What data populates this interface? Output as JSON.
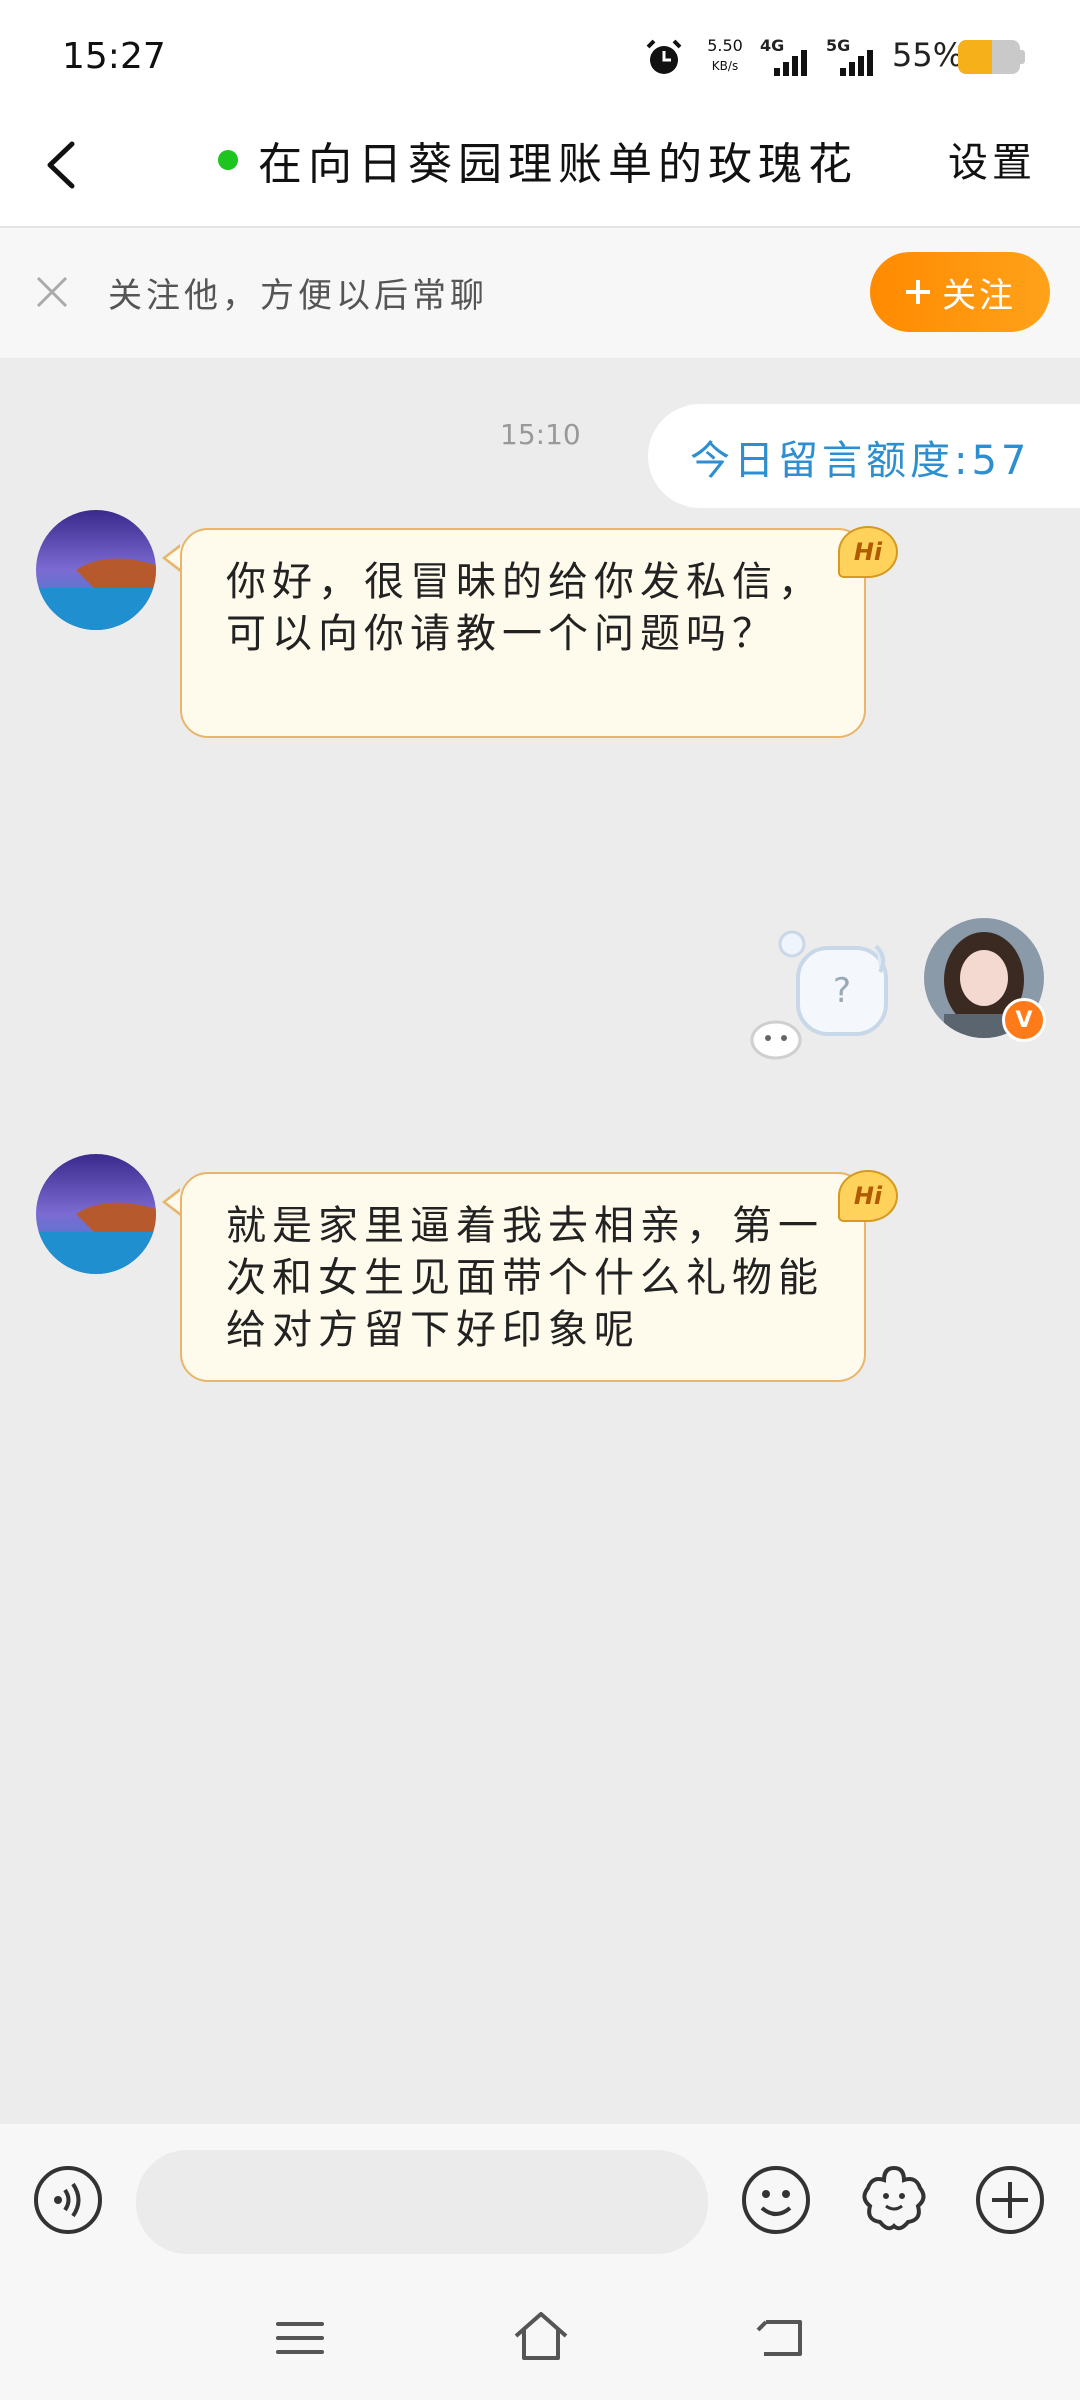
{
  "status_bar": {
    "time": "15:27",
    "net_speed_value": "5.50",
    "net_speed_unit": "KB/s",
    "signal_1_label": "4G",
    "signal_2_label": "5G",
    "battery_percent": "55%",
    "battery_level": 0.55,
    "battery_color": "#f6b11a"
  },
  "header": {
    "title": "在向日葵园理账单的玫瑰花",
    "settings_label": "设置",
    "online_color": "#1ec51e"
  },
  "follow_bar": {
    "hint": "关注他，方便以后常聊",
    "button_label": "关注",
    "button_color": "#ff8a00"
  },
  "chat": {
    "timestamp": "15:10",
    "quota_text": "今日留言额度:57",
    "messages": [
      {
        "from": "other",
        "text": "你好，很冒昧的给你发私信，可以向你请教一个问题吗？",
        "badge": "Hi"
      },
      {
        "from": "self",
        "sticker": "question-mark-bubble",
        "badge_symbol": "?"
      },
      {
        "from": "other",
        "text": "就是家里逼着我去相亲，第一次和女生见面带个什么礼物能给对方留下好印象呢",
        "badge": "Hi"
      }
    ],
    "verified_symbol": "V"
  },
  "input_bar": {
    "placeholder": "",
    "icons": [
      "voice-icon",
      "emoji-icon",
      "sticker-flower-icon",
      "plus-icon"
    ]
  },
  "nav_bar": {
    "icons": [
      "menu-icon",
      "home-icon",
      "back-icon"
    ]
  }
}
